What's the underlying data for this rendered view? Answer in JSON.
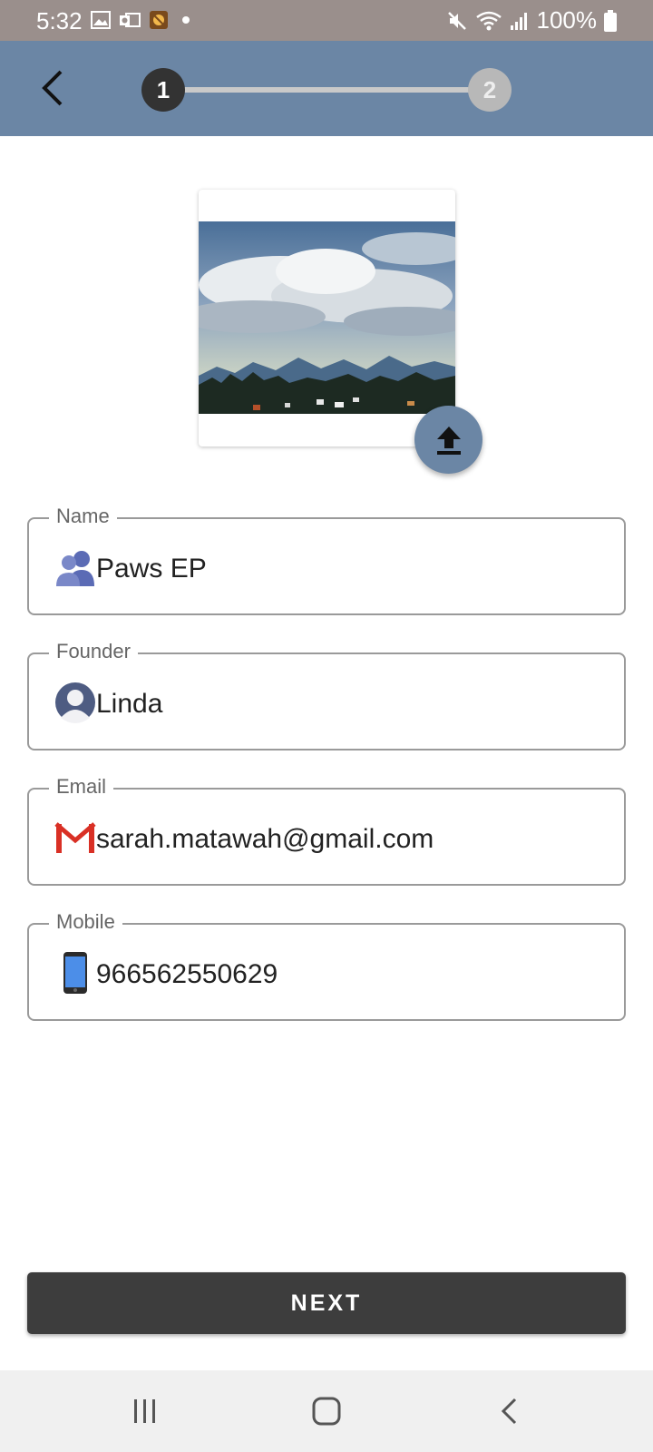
{
  "status_bar": {
    "time": "5:32",
    "notification_icons": [
      "gallery-icon",
      "outlook-icon",
      "app-icon",
      "dot-icon"
    ],
    "battery": "100%",
    "system_icons": [
      "mute-icon",
      "wifi-icon",
      "signal-icon",
      "battery-icon"
    ]
  },
  "header": {
    "back_icon": "chevron-left-icon",
    "steps": [
      {
        "label": "1",
        "state": "active"
      },
      {
        "label": "2",
        "state": "inactive"
      }
    ]
  },
  "photo": {
    "description_icon": "landscape-photo",
    "upload_icon": "upload-icon"
  },
  "form": {
    "name": {
      "label": "Name",
      "value": "Paws EP",
      "icon": "people-icon"
    },
    "founder": {
      "label": "Founder",
      "value": "Linda",
      "icon": "person-icon"
    },
    "email": {
      "label": "Email",
      "value": "sarah.matawah@gmail.com",
      "icon": "gmail-icon"
    },
    "mobile": {
      "label": "Mobile",
      "value": "966562550629",
      "icon": "phone-icon"
    }
  },
  "actions": {
    "next_label": "NEXT"
  },
  "colors": {
    "status_bar": "#9a8f8c",
    "app_bar": "#6b86a5",
    "accent": "#6b86a5",
    "step_active": "#333333",
    "step_inactive": "#b8b8b8",
    "button": "#3d3d3d"
  }
}
